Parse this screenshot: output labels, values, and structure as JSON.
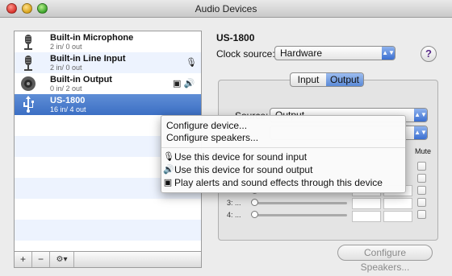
{
  "window": {
    "title": "Audio Devices"
  },
  "devices": [
    {
      "name": "Built-in Microphone",
      "io": "2 in/ 0 out",
      "icon": "microphone-icon",
      "badges": ""
    },
    {
      "name": "Built-in Line Input",
      "io": "2 in/ 0 out",
      "icon": "microphone-icon",
      "badges": "🎙"
    },
    {
      "name": "Built-in Output",
      "io": "0 in/ 2 out",
      "icon": "speaker-icon",
      "badges": "▣ 🔊"
    },
    {
      "name": "US-1800",
      "io": "16 in/ 4 out",
      "icon": "usb-icon",
      "badges": "",
      "selected": true
    }
  ],
  "listbar": {
    "add": "+",
    "remove": "−",
    "gear": "⚙▾"
  },
  "detail": {
    "device_title": "US-1800",
    "clock_label": "Clock source:",
    "clock_value": "Hardware",
    "help": "?",
    "tabs": [
      "Input",
      "Output"
    ],
    "active_tab": "Output",
    "source_label": "Source:",
    "source_value": "Output",
    "mute_header": "Mute",
    "channels": [
      {
        "label": "3: ..."
      },
      {
        "label": "4: ..."
      }
    ],
    "configure_speakers": "Configure Speakers..."
  },
  "context_menu": {
    "items": [
      {
        "label": "Configure device...",
        "glyph": ""
      },
      {
        "label": "Configure speakers...",
        "glyph": ""
      },
      {
        "label": "Use this device for sound input",
        "glyph": "🎙"
      },
      {
        "label": "Use this device for sound output",
        "glyph": "🔊"
      },
      {
        "label": "Play alerts and sound effects through this device",
        "glyph": "▣"
      }
    ]
  },
  "colors": {
    "selection": "#3c6fc4",
    "stripe": "#edf3fe",
    "accent": "#5b8ad7"
  }
}
